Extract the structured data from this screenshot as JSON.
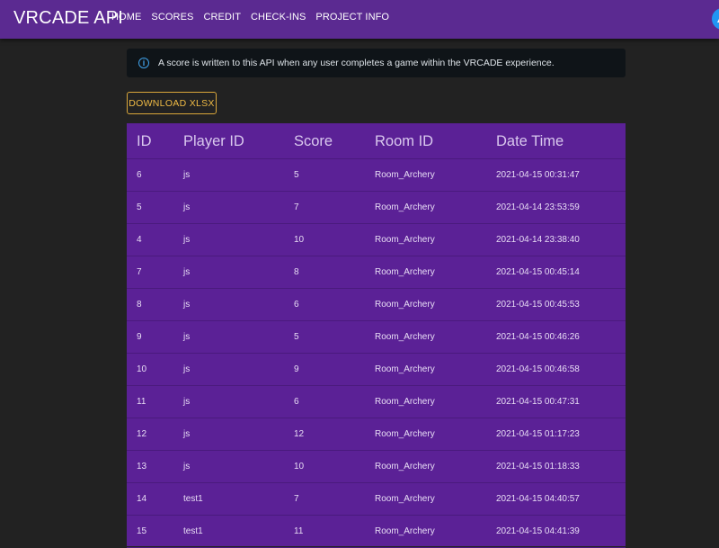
{
  "app": {
    "title": "VRCADE API"
  },
  "nav": {
    "items": [
      {
        "label": "HOME"
      },
      {
        "label": "SCORES"
      },
      {
        "label": "CREDIT"
      },
      {
        "label": "CHECK-INS"
      },
      {
        "label": "PROJECT INFO"
      }
    ]
  },
  "alert": {
    "icon": "info-icon",
    "text": "A score is written to this API when any user completes a game within the VRCADE experience."
  },
  "download": {
    "label": "DOWNLOAD XLSX"
  },
  "table": {
    "headers": [
      "ID",
      "Player ID",
      "Score",
      "Room ID",
      "Date Time"
    ],
    "rows": [
      [
        "6",
        "js",
        "5",
        "Room_Archery",
        "2021-04-15 00:31:47"
      ],
      [
        "5",
        "js",
        "7",
        "Room_Archery",
        "2021-04-14 23:53:59"
      ],
      [
        "4",
        "js",
        "10",
        "Room_Archery",
        "2021-04-14 23:38:40"
      ],
      [
        "7",
        "js",
        "8",
        "Room_Archery",
        "2021-04-15 00:45:14"
      ],
      [
        "8",
        "js",
        "6",
        "Room_Archery",
        "2021-04-15 00:45:53"
      ],
      [
        "9",
        "js",
        "5",
        "Room_Archery",
        "2021-04-15 00:46:26"
      ],
      [
        "10",
        "js",
        "9",
        "Room_Archery",
        "2021-04-15 00:46:58"
      ],
      [
        "11",
        "js",
        "6",
        "Room_Archery",
        "2021-04-15 00:47:31"
      ],
      [
        "12",
        "js",
        "12",
        "Room_Archery",
        "2021-04-15 01:17:23"
      ],
      [
        "13",
        "js",
        "10",
        "Room_Archery",
        "2021-04-15 01:18:33"
      ],
      [
        "14",
        "test1",
        "7",
        "Room_Archery",
        "2021-04-15 04:40:57"
      ],
      [
        "15",
        "test1",
        "11",
        "Room_Archery",
        "2021-04-15 04:41:39"
      ]
    ]
  },
  "colors": {
    "navbar": "#5b2a91",
    "background": "#222222",
    "table": "#5b2196",
    "accent_button": "#f0bb45",
    "info": "#3fa0e8"
  }
}
